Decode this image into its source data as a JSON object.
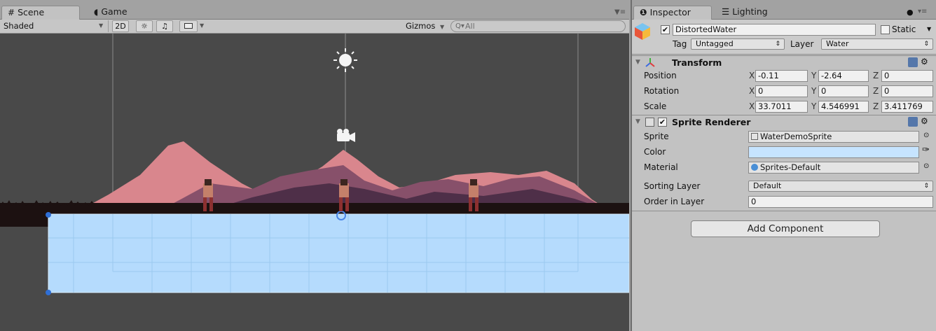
{
  "scene_tabs": {
    "scene": "Scene",
    "game": "Game"
  },
  "scene_toolbar": {
    "shading": "Shaded",
    "mode_2d": "2D",
    "gizmos": "Gizmos",
    "search_placeholder": "All"
  },
  "inspector_tabs": {
    "inspector": "Inspector",
    "lighting": "Lighting"
  },
  "object": {
    "name": "DistortedWater",
    "active": true,
    "static_label": "Static",
    "tag_label": "Tag",
    "tag_value": "Untagged",
    "layer_label": "Layer",
    "layer_value": "Water"
  },
  "transform": {
    "title": "Transform",
    "position_label": "Position",
    "rotation_label": "Rotation",
    "scale_label": "Scale",
    "axis_x": "X",
    "axis_y": "Y",
    "axis_z": "Z",
    "position": {
      "x": "-0.11",
      "y": "-2.64",
      "z": "0"
    },
    "rotation": {
      "x": "0",
      "y": "0",
      "z": "0"
    },
    "scale": {
      "x": "33.7011",
      "y": "4.546991",
      "z": "3.411769"
    }
  },
  "sprite_renderer": {
    "title": "Sprite Renderer",
    "enabled": true,
    "sprite_label": "Sprite",
    "sprite_value": "WaterDemoSprite",
    "color_label": "Color",
    "color_value": "#c6e4ff",
    "material_label": "Material",
    "material_value": "Sprites-Default",
    "sorting_layer_label": "Sorting Layer",
    "sorting_layer_value": "Default",
    "order_label": "Order in Layer",
    "order_value": "0"
  },
  "add_component_label": "Add Component",
  "colors": {
    "viewport_bg": "#494949",
    "water": "#b5dbfd",
    "mountain_light": "#d9868d",
    "mountain_mid": "#87506a",
    "mountain_dark": "#4e2f48",
    "ground": "#1c1111",
    "handle": "#2f6fd6"
  },
  "icons": {
    "scene_tab": "grid-icon",
    "game_tab": "pacman-icon",
    "inspector_tab": "info-icon",
    "lighting_tab": "lighting-icon",
    "sun_gizmo": "sun-icon",
    "camera_gizmo": "camera-icon",
    "lock": "lock-icon",
    "menu": "menu-icon"
  }
}
